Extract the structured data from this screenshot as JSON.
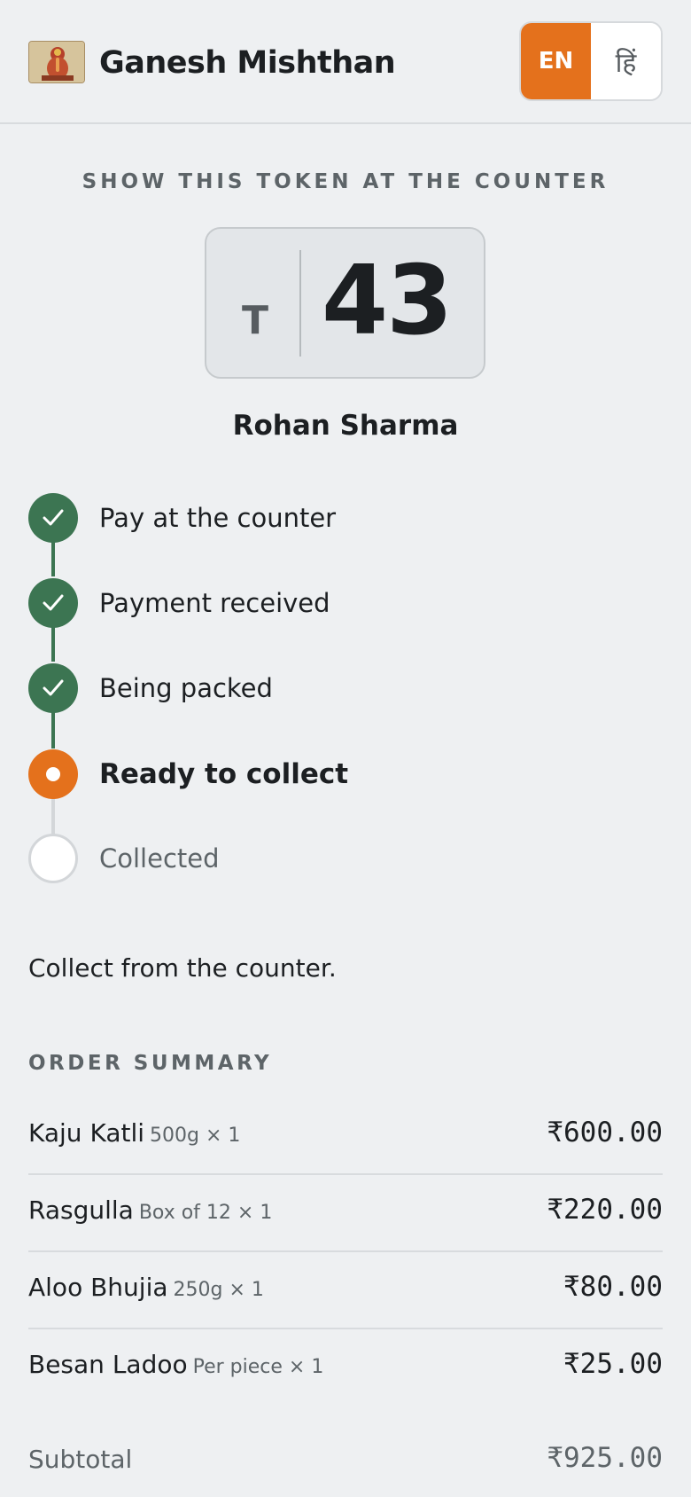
{
  "header": {
    "logo_icon": "ganesha-logo-icon",
    "shop_name": "Ganesh Mishthan",
    "lang_en": "EN",
    "lang_hi": "हिं"
  },
  "token": {
    "caption": "SHOW THIS TOKEN AT THE COUNTER",
    "prefix": "T",
    "number": "43",
    "customer_name": "Rohan Sharma"
  },
  "steps": [
    {
      "label": "Pay at the counter",
      "state": "done"
    },
    {
      "label": "Payment received",
      "state": "done"
    },
    {
      "label": "Being packed",
      "state": "done"
    },
    {
      "label": "Ready to collect",
      "state": "current"
    },
    {
      "label": "Collected",
      "state": "pending"
    }
  ],
  "collect_note": "Collect from the counter.",
  "summary": {
    "title": "ORDER SUMMARY",
    "items": [
      {
        "name": "Kaju Katli",
        "variant": "500g × 1",
        "price": "₹600.00"
      },
      {
        "name": "Rasgulla",
        "variant": "Box of 12 × 1",
        "price": "₹220.00"
      },
      {
        "name": "Aloo Bhujia",
        "variant": "250g × 1",
        "price": "₹80.00"
      },
      {
        "name": "Besan Ladoo",
        "variant": "Per piece × 1",
        "price": "₹25.00"
      }
    ],
    "subtotal_label": "Subtotal",
    "subtotal_value": "₹925.00"
  },
  "colors": {
    "accent": "#e4711c",
    "done": "#3c7552",
    "background": "#eef0f2"
  }
}
